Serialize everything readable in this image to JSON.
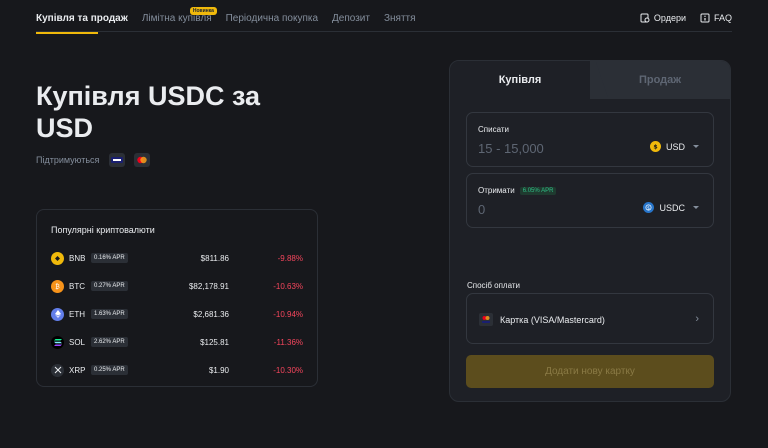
{
  "nav": {
    "tabs": [
      {
        "label": "Купівля та продаж",
        "active": true
      },
      {
        "label": "Лімітна купівля",
        "badge": "Новинка"
      },
      {
        "label": "Періодична покупка"
      },
      {
        "label": "Депозит"
      },
      {
        "label": "Зняття"
      }
    ],
    "orders_label": "Ордери",
    "faq_label": "FAQ"
  },
  "hero": {
    "title": "Купівля USDC за USD",
    "supported_label": "Підтримуються"
  },
  "popular": {
    "title": "Популярні криптовалюти",
    "rows": [
      {
        "symbol": "BNB",
        "apr": "0.16% APR",
        "price": "$811.86",
        "change": "-9.88%",
        "icon": "bnb-icon",
        "color": "#f0b90b"
      },
      {
        "symbol": "BTC",
        "apr": "0.27% APR",
        "price": "$82,178.91",
        "change": "-10.63%",
        "icon": "btc-icon",
        "color": "#f7931a"
      },
      {
        "symbol": "ETH",
        "apr": "1.63% APR",
        "price": "$2,681.36",
        "change": "-10.94%",
        "icon": "eth-icon",
        "color": "#627eea"
      },
      {
        "symbol": "SOL",
        "apr": "2.62% APR",
        "price": "$125.81",
        "change": "-11.36%",
        "icon": "sol-icon",
        "color": "#000000"
      },
      {
        "symbol": "XRP",
        "apr": "0.25% APR",
        "price": "$1.90",
        "change": "-10.30%",
        "icon": "xrp-icon",
        "color": "#2b2f36"
      }
    ]
  },
  "panel": {
    "buy_tab": "Купівля",
    "sell_tab": "Продаж",
    "spend": {
      "label": "Списати",
      "placeholder": "15 - 15,000",
      "currency": "USD"
    },
    "receive": {
      "label": "Отримати",
      "apr": "6.05% APR",
      "placeholder": "0",
      "currency": "USDC"
    },
    "method_label": "Спосіб оплати",
    "method_value": "Картка (VISA/Mastercard)",
    "add_card": "Додати нову картку"
  },
  "colors": {
    "accent": "#f0b90b",
    "negative": "#f6465d",
    "positive": "#2ebd85"
  }
}
